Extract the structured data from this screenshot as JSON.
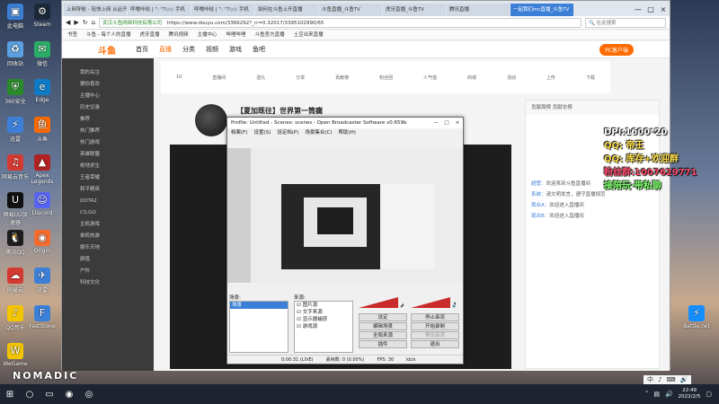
{
  "desktop": {
    "left_icons": [
      {
        "label": "此电脑",
        "icon": "computer-icon",
        "color": "#3b7fd6"
      },
      {
        "label": "回收站",
        "icon": "recycle-bin-icon",
        "color": "#5aa0e0"
      },
      {
        "label": "360安全",
        "icon": "shield-icon",
        "color": "#2a8a2a"
      },
      {
        "label": "迅雷",
        "icon": "thunder-icon",
        "color": "#3b7fd6"
      },
      {
        "label": "网易云音乐",
        "icon": "music-icon",
        "color": "#d33a31"
      },
      {
        "label": "网易UU加速器",
        "icon": "uu-icon",
        "color": "#111111"
      },
      {
        "label": "腾讯QQ",
        "icon": "qq-icon",
        "color": "#1e1e1e"
      },
      {
        "label": "网易云",
        "icon": "cloud-icon",
        "color": "#d33a31"
      },
      {
        "label": "QQ音乐",
        "icon": "qqmusic-icon",
        "color": "#f2c500"
      },
      {
        "label": "WeGame",
        "icon": "wegame-icon",
        "color": "#f2c500"
      }
    ],
    "right_icons": [
      {
        "label": "Steam",
        "icon": "steam-icon",
        "color": "#1b2838"
      },
      {
        "label": "微信",
        "icon": "wechat-icon",
        "color": "#2aae67"
      },
      {
        "label": "Edge",
        "icon": "edge-icon",
        "color": "#0f7bc4"
      },
      {
        "label": "斗鱼",
        "icon": "douyu-icon",
        "color": "#ff6a00"
      },
      {
        "label": "Apex Legends",
        "icon": "apex-icon",
        "color": "#b22222"
      },
      {
        "label": "Discord",
        "icon": "discord-icon",
        "color": "#5865f2"
      },
      {
        "label": "Origin",
        "icon": "origin-icon",
        "color": "#f56c2d"
      },
      {
        "label": "迅雷",
        "icon": "bird-icon",
        "color": "#3b7fd6"
      },
      {
        "label": "FastStone",
        "icon": "faststone-icon",
        "color": "#3b7fd6"
      }
    ],
    "far_right_icon": {
      "label": "Battle.net",
      "icon": "battlenet-icon",
      "color": "#148eff"
    }
  },
  "browser": {
    "tabs": [
      "上网导航 - 轻快上网 从此开始",
      "呼噜咔哒 | \"- \"7◇◇ 手机",
      "呼噜咔哒 | \"- \"7◇◇ 手机",
      "如何在斗鱼上开直播",
      "斗鱼直播_斗鱼TV",
      "虎牙直播_斗鱼TV",
      "腾讯直播",
      "一起我们mc直播_斗鱼TV"
    ],
    "active_tab": 7,
    "window_controls": [
      "—",
      "□",
      "×"
    ],
    "address": "https://www.douyu.com/3366292?_rr=0.32017/3395102990/65",
    "site_badge": "武汉斗鱼网络科技有限公司",
    "search_placeholder": "在此搜索",
    "bookmarks": [
      "书签",
      "斗鱼 - 每个人的直播",
      "虎牙直播",
      "腾讯视频",
      "主播中心",
      "哔哩哔哩",
      "斗鱼官方直播",
      "土豆出来直播"
    ]
  },
  "site": {
    "logo": "斗鱼",
    "nav": [
      "首页",
      "直播",
      "分类",
      "视频",
      "游戏",
      "鱼吧"
    ],
    "nav_active": 1,
    "download_label": "PC客户端",
    "sidebar": [
      "我的关注",
      "猜你喜欢",
      "主播中心",
      "历史记录",
      "推荐",
      "热门推荐",
      "热门游戏",
      "英雄联盟",
      "绝地求生",
      "王者荣耀",
      "和平精英",
      "DOTA2",
      "CS:GO",
      "主机游戏",
      "单机热游",
      "娱乐天地",
      "颜值",
      "户外",
      "科技文化"
    ],
    "icon_row": [
      "10",
      "直播间",
      "送礼",
      "分享",
      "贡献榜",
      "粉丝团",
      "人气值",
      "商城",
      "活动",
      "上传",
      "下载"
    ],
    "room_title": "【夏加既往】世界第一筒瘸",
    "chat_header": "贡献周榜 贡献总榜",
    "chat_lines": [
      {
        "user": "超管：",
        "text": "欢迎来到斗鱼直播间"
      },
      {
        "user": "系统：",
        "text": "请文明发言，遵守直播规范"
      },
      {
        "user": "观众A：",
        "text": "欢迎进入直播间"
      },
      {
        "user": "观众B：",
        "text": "欢迎进入直播间"
      }
    ]
  },
  "obs": {
    "title": "Profile: Untitled - Scenes: scenes - Open Broadcaster Software v0.659b",
    "menu": [
      "档案(F)",
      "设置(S)",
      "设定档(P)",
      "场景集合(C)",
      "帮助(H)"
    ],
    "scenes_label": "场景:",
    "sources_label": "来源:",
    "scenes": [
      "场景"
    ],
    "sources": [
      "图片源",
      "文字来源",
      "显示器捕获",
      "游戏源"
    ],
    "buttons": [
      "设定",
      "编辑场景",
      "全局来源",
      "插件",
      "停止串流",
      "开始录制",
      "预览串流",
      "退出"
    ],
    "status": [
      "0:00:31 (LIVE)",
      "丢帧数: 0 (0.00%)",
      "FPS: 30",
      "kb/s"
    ]
  },
  "overlay": {
    "lines": [
      {
        "text": "DPI:1600*20",
        "color": "white"
      },
      {
        "text": "QQ: 帝王",
        "color": "yellow"
      },
      {
        "text": "QQ: 库存+欢迎群",
        "color": "yellow"
      },
      {
        "text": "粉丝群:1007629771",
        "color": "red"
      },
      {
        "text": "接陪玩·带私聊",
        "color": "green"
      }
    ]
  },
  "watermark": "NOMADIC",
  "taskbar": {
    "apps": [
      "start-icon",
      "search-icon",
      "taskview-icon",
      "obs-icon",
      "browser-icon"
    ],
    "ime": [
      "中",
      "♪",
      "⌨",
      "🔊"
    ],
    "time": "22:49",
    "date": "2022/2/5"
  }
}
